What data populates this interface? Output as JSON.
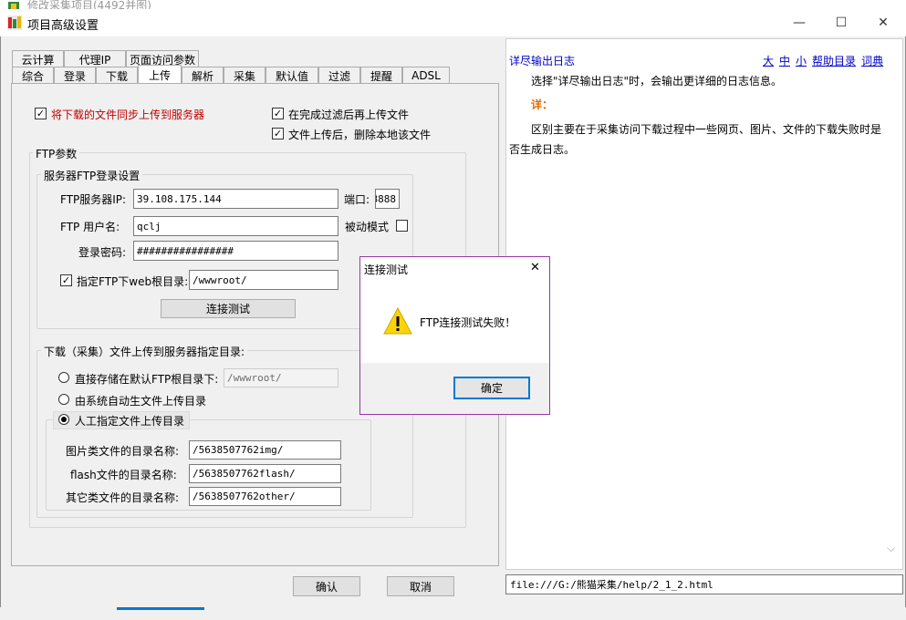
{
  "background_window": {
    "title": "修改采集项目(4492并图)"
  },
  "window": {
    "title": "项目高级设置",
    "controls": {
      "minimize": "—",
      "maximize": "☐",
      "close": "✕"
    }
  },
  "tabs": {
    "row1": [
      "云计算",
      "代理IP",
      "页面访问参数"
    ],
    "row2": [
      "综合",
      "登录",
      "下载",
      "上传",
      "解析",
      "采集",
      "默认值",
      "过滤",
      "提醒",
      "ADSL"
    ],
    "active": "上传"
  },
  "upload": {
    "sync_upload_label": "将下载的文件同步上传到服务器",
    "upload_after_filter_label": "在完成过滤后再上传文件",
    "delete_local_label": "文件上传后，删除本地该文件",
    "ftp_group_label": "FTP参数",
    "server_group_label": "服务器FTP登录设置",
    "server_ip_label": "FTP服务器IP:",
    "server_ip_value": "39.108.175.144",
    "port_label": "端口:",
    "port_value": "8888",
    "username_label": "FTP  用户名:",
    "username_value": "qclj",
    "passive_label": "被动模式",
    "password_label": "登录密码:",
    "password_value": "################",
    "webroot_label": "指定FTP下web根目录:",
    "webroot_value": "/wwwroot/",
    "test_button": "连接测试",
    "target_group_label": "下载（采集）文件上传到服务器指定目录:",
    "radio_default_label": "直接存储在默认FTP根目录下:",
    "radio_default_value": "/wwwroot/",
    "radio_auto_label": "由系统自动生文件上传目录",
    "radio_manual_label": "人工指定文件上传目录",
    "image_dir_label": "图片类文件的目录名称:",
    "image_dir_value": "/5638507762img/",
    "flash_dir_label": "flash文件的目录名称:",
    "flash_dir_value": "/5638507762flash/",
    "other_dir_label": "其它类文件的目录名称:",
    "other_dir_value": "/5638507762other/"
  },
  "footer": {
    "ok": "确认",
    "cancel": "取消"
  },
  "help": {
    "title": "详尽输出日志",
    "links": [
      "大",
      "中",
      "小",
      "帮助目录",
      "词典"
    ],
    "line1": "选择\"详尽输出日志\"时，会输出更详细的日志信息。",
    "detail_label": "详：",
    "line2": "区别主要在于采集访问下载过程中一些网页、图片、文件的下载失败时是否生成日志。",
    "url": "file:///G:/熊猫采集/help/2_1_2.html"
  },
  "dialog": {
    "title": "连接测试",
    "close": "✕",
    "message": "FTP连接测试失败！",
    "ok": "确定"
  },
  "colors": {
    "accent_red": "#c00000",
    "link_blue": "#0000c8",
    "dialog_border": "#9a36a8",
    "help_title": "#0000c8",
    "detail_orange": "#e06c00"
  }
}
